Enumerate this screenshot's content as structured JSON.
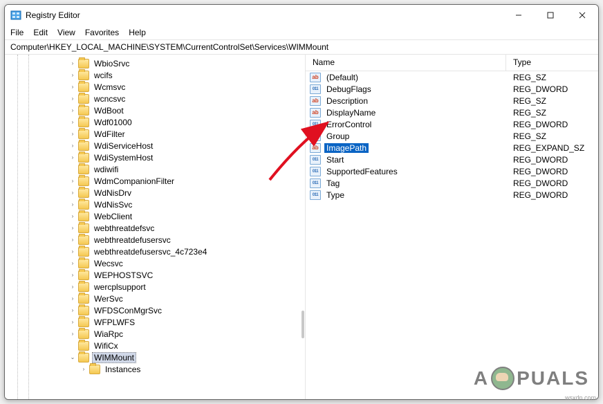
{
  "window": {
    "title": "Registry Editor"
  },
  "menu": {
    "file": "File",
    "edit": "Edit",
    "view": "View",
    "favorites": "Favorites",
    "help": "Help"
  },
  "address": "Computer\\HKEY_LOCAL_MACHINE\\SYSTEM\\CurrentControlSet\\Services\\WIMMount",
  "tree": [
    {
      "label": "WbioSrvc",
      "depth": 6,
      "exp": ">"
    },
    {
      "label": "wcifs",
      "depth": 6,
      "exp": ">"
    },
    {
      "label": "Wcmsvc",
      "depth": 6,
      "exp": ">"
    },
    {
      "label": "wcncsvc",
      "depth": 6,
      "exp": ">"
    },
    {
      "label": "WdBoot",
      "depth": 6,
      "exp": ">"
    },
    {
      "label": "Wdf01000",
      "depth": 6,
      "exp": ">"
    },
    {
      "label": "WdFilter",
      "depth": 6,
      "exp": ">"
    },
    {
      "label": "WdiServiceHost",
      "depth": 6,
      "exp": ">"
    },
    {
      "label": "WdiSystemHost",
      "depth": 6,
      "exp": ">"
    },
    {
      "label": "wdiwifi",
      "depth": 6,
      "exp": ""
    },
    {
      "label": "WdmCompanionFilter",
      "depth": 6,
      "exp": ">"
    },
    {
      "label": "WdNisDrv",
      "depth": 6,
      "exp": ">"
    },
    {
      "label": "WdNisSvc",
      "depth": 6,
      "exp": ">"
    },
    {
      "label": "WebClient",
      "depth": 6,
      "exp": ">"
    },
    {
      "label": "webthreatdefsvc",
      "depth": 6,
      "exp": ">"
    },
    {
      "label": "webthreatdefusersvc",
      "depth": 6,
      "exp": ">"
    },
    {
      "label": "webthreatdefusersvc_4c723e4",
      "depth": 6,
      "exp": ">"
    },
    {
      "label": "Wecsvc",
      "depth": 6,
      "exp": ">"
    },
    {
      "label": "WEPHOSTSVC",
      "depth": 6,
      "exp": ">"
    },
    {
      "label": "wercplsupport",
      "depth": 6,
      "exp": ">"
    },
    {
      "label": "WerSvc",
      "depth": 6,
      "exp": ">"
    },
    {
      "label": "WFDSConMgrSvc",
      "depth": 6,
      "exp": ">"
    },
    {
      "label": "WFPLWFS",
      "depth": 6,
      "exp": ">"
    },
    {
      "label": "WiaRpc",
      "depth": 6,
      "exp": ">"
    },
    {
      "label": "WifiCx",
      "depth": 6,
      "exp": ""
    },
    {
      "label": "WIMMount",
      "depth": 6,
      "exp": "v",
      "selected": true
    },
    {
      "label": "Instances",
      "depth": 7,
      "exp": ">"
    }
  ],
  "list_header": {
    "name": "Name",
    "type": "Type"
  },
  "values": [
    {
      "name": "(Default)",
      "type": "REG_SZ",
      "kind": "str"
    },
    {
      "name": "DebugFlags",
      "type": "REG_DWORD",
      "kind": "bin"
    },
    {
      "name": "Description",
      "type": "REG_SZ",
      "kind": "str"
    },
    {
      "name": "DisplayName",
      "type": "REG_SZ",
      "kind": "str"
    },
    {
      "name": "ErrorControl",
      "type": "REG_DWORD",
      "kind": "bin"
    },
    {
      "name": "Group",
      "type": "REG_SZ",
      "kind": "str"
    },
    {
      "name": "ImagePath",
      "type": "REG_EXPAND_SZ",
      "kind": "str",
      "selected": true
    },
    {
      "name": "Start",
      "type": "REG_DWORD",
      "kind": "bin"
    },
    {
      "name": "SupportedFeatures",
      "type": "REG_DWORD",
      "kind": "bin"
    },
    {
      "name": "Tag",
      "type": "REG_DWORD",
      "kind": "bin"
    },
    {
      "name": "Type",
      "type": "REG_DWORD",
      "kind": "bin"
    }
  ],
  "watermark": {
    "pre": "A",
    "post": "PUALS"
  },
  "footer": "wsxdn.com"
}
